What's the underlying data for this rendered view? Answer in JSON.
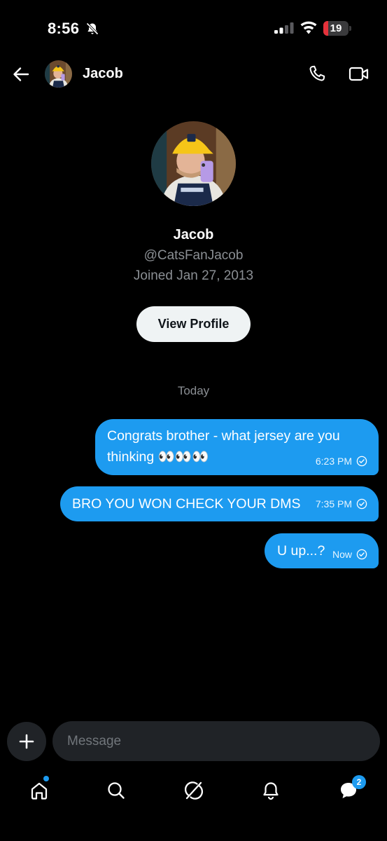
{
  "status_bar": {
    "time": "8:56",
    "battery": "19",
    "battery_level": 0.19,
    "battery_color": "#e5323b"
  },
  "header": {
    "name": "Jacob",
    "back_icon": "arrow-left-icon",
    "call_icon": "phone-icon",
    "video_icon": "video-camera-icon"
  },
  "profile": {
    "name": "Jacob",
    "handle": "@CatsFanJacob",
    "joined": "Joined Jan 27, 2013",
    "view_profile_label": "View Profile"
  },
  "date_separator": "Today",
  "messages": [
    {
      "text": "Congrats brother - what jersey are you thinking 👀👀👀",
      "time": "6:23 PM",
      "status": "read"
    },
    {
      "text": "BRO YOU WON CHECK YOUR DMS",
      "time": "7:35 PM",
      "status": "read"
    },
    {
      "text": "U up...?",
      "time": "Now",
      "status": "read"
    }
  ],
  "composer": {
    "placeholder": "Message"
  },
  "tabbar": {
    "items": [
      {
        "icon": "home-icon",
        "has_dot": true
      },
      {
        "icon": "search-icon"
      },
      {
        "icon": "grok-icon"
      },
      {
        "icon": "bell-icon"
      },
      {
        "icon": "messages-icon",
        "badge": "2"
      }
    ]
  },
  "colors": {
    "accent": "#1d9bf0",
    "background": "#000000",
    "muted_text": "#8b8f94",
    "input_bg": "#202327"
  }
}
